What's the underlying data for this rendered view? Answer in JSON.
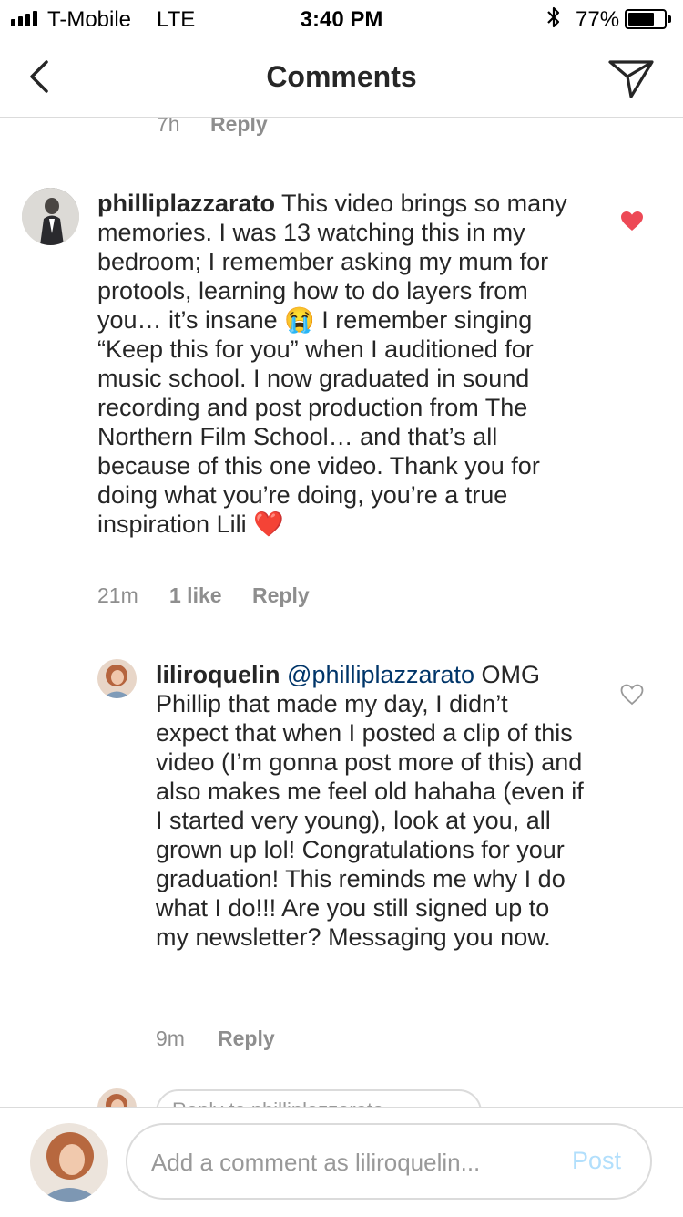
{
  "status_bar": {
    "carrier": "T-Mobile",
    "network": "LTE",
    "time": "3:40 PM",
    "battery": "77%",
    "battery_level": 0.77
  },
  "header": {
    "title": "Comments",
    "back_icon": "chevron-left-icon",
    "share_icon": "paper-plane-icon"
  },
  "previous_comment": {
    "time": "7h",
    "reply": "Reply"
  },
  "comment": {
    "username": "philliplazzarato",
    "text": " This video brings so many memories. I was 13 watching this in my bedroom; I remember asking my mum for protools, learning how to do layers from you… it’s insane 😭 I remember singing “Keep this for you” when I auditioned for music school. I now graduated in sound recording and post production from The Northern Film School… and that’s all because of this one video. Thank you for doing what you’re doing, you’re a true inspiration Lili ❤️",
    "time": "21m",
    "likes": "1 like",
    "reply": "Reply",
    "liked": true
  },
  "reply": {
    "username": "liliroquelin",
    "mention": "@philliplazzarato",
    "text": " OMG Phillip that made my day, I didn’t expect that when I posted a clip of this video (I’m gonna post more of this) and also makes me feel old hahaha (even if I started very young), look at you, all grown up lol! Congratulations for your graduation! This reminds me why I do what I do!!! Are you still signed up to my newsletter? Messaging you now.",
    "time": "9m",
    "reply": "Reply",
    "liked": false
  },
  "reply_box": {
    "placeholder": "Reply to philliplazzarato"
  },
  "composer": {
    "placeholder": "Add a comment as liliroquelin...",
    "post_label": "Post"
  },
  "colors": {
    "heart_liked": "#ed4956",
    "post_disabled": "#b2dffc",
    "mention": "#003569"
  }
}
